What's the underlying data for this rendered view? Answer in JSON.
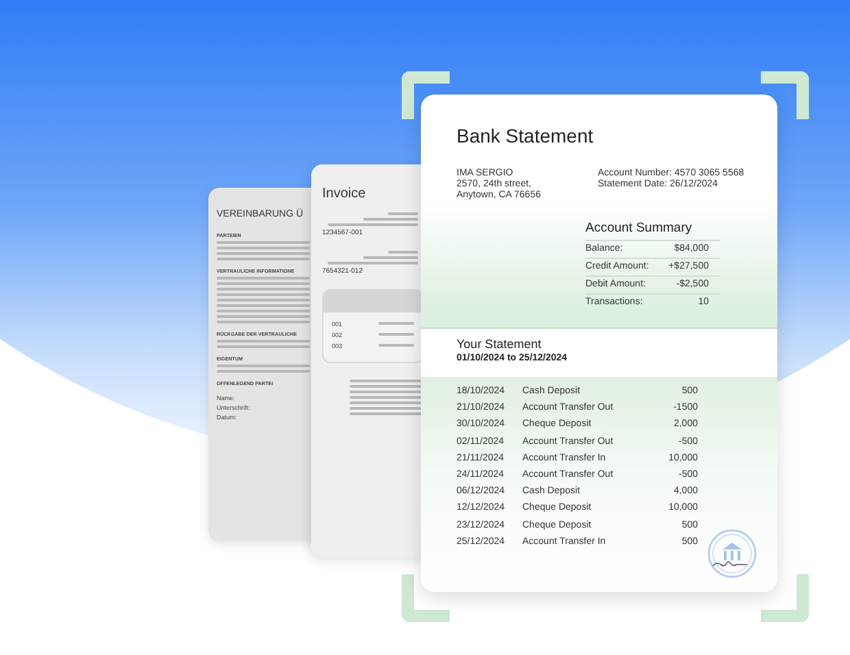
{
  "agreement": {
    "title": "VEREINBARUNG Ü",
    "sections": [
      "PARTEIEN",
      "VERTRAULICHE INFORMATIONE",
      "RÜCKGABE DER VERTRAULICHE",
      "EIGENTUM",
      "OFFENLEGEND PARTEI"
    ],
    "fields": [
      "Name:",
      "Unterschrift:",
      "Datum:"
    ]
  },
  "invoice": {
    "title": "Invoice",
    "phones": [
      "1234567-001",
      "7654321-012"
    ],
    "items": [
      "001",
      "002",
      "003"
    ]
  },
  "statement": {
    "title": "Bank Statement",
    "address": [
      "IMA SERGIO",
      "2570, 24th street,",
      "Anytown, CA 76656"
    ],
    "account_info": [
      "Account Number: 4570 3065 5568",
      "Statement Date: 26/12/2024"
    ],
    "summary": {
      "title": "Account Summary",
      "rows": [
        {
          "label": "Balance:",
          "value": "$84,000"
        },
        {
          "label": "Credit Amount:",
          "value": "+$27,500"
        },
        {
          "label": "Debit Amount:",
          "value": "-$2,500"
        },
        {
          "label": "Transactions:",
          "value": "10"
        }
      ]
    },
    "period_title": "Your Statement",
    "period": "01/10/2024 to 25/12/2024",
    "transactions": [
      {
        "date": "18/10/2024",
        "description": "Cash Deposit",
        "amount": "500"
      },
      {
        "date": "21/10/2024",
        "description": "Account Transfer Out",
        "amount": "-1500"
      },
      {
        "date": "30/10/2024",
        "description": "Cheque Deposit",
        "amount": "2,000"
      },
      {
        "date": "02/11/2024",
        "description": "Account Transfer Out",
        "amount": "-500"
      },
      {
        "date": "21/11/2024",
        "description": "Account Transfer In",
        "amount": "10,000"
      },
      {
        "date": "24/11/2024",
        "description": "Account Transfer Out",
        "amount": "-500"
      },
      {
        "date": "06/12/2024",
        "description": "Cash Deposit",
        "amount": "4,000"
      },
      {
        "date": "12/12/2024",
        "description": "Cheque Deposit",
        "amount": "10,000"
      },
      {
        "date": "23/12/2024",
        "description": "Cheque Deposit",
        "amount": "500"
      },
      {
        "date": "25/12/2024",
        "description": "Account Transfer In",
        "amount": "500"
      }
    ]
  }
}
